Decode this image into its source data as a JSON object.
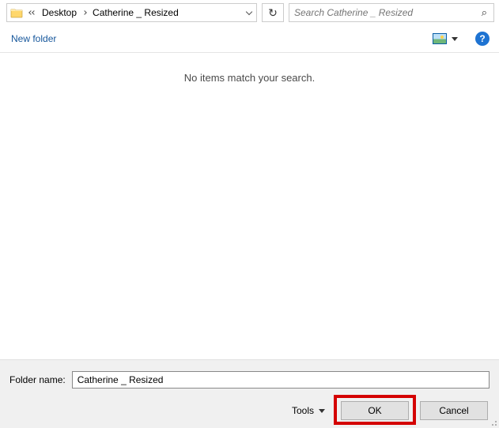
{
  "breadcrumb": {
    "segments": [
      "Desktop",
      "Catherine _ Resized"
    ]
  },
  "search": {
    "placeholder": "Search Catherine _ Resized"
  },
  "toolbar": {
    "new_folder_label": "New folder",
    "help_label": "?"
  },
  "main": {
    "empty_message": "No items match your search."
  },
  "footer": {
    "folder_name_label": "Folder name:",
    "folder_name_value": "Catherine _ Resized",
    "tools_label": "Tools",
    "ok_label": "OK",
    "cancel_label": "Cancel"
  }
}
